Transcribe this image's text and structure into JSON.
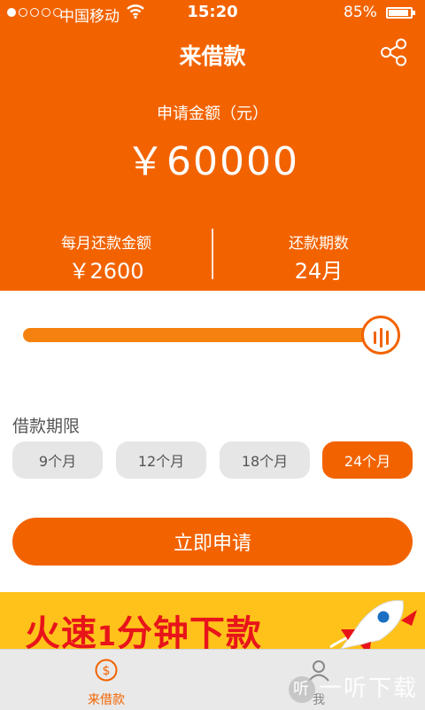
{
  "status_bar": {
    "carrier": "中国移动",
    "time": "15:20",
    "battery": "85%",
    "battery_level": 0.85,
    "signal_filled": 1,
    "signal_total": 5
  },
  "header": {
    "title": "来借款",
    "share_icon": "share-icon",
    "amount_label": "申请金额（元）",
    "amount_value": "￥60000",
    "monthly_label": "每月还款金额",
    "monthly_value": "￥2600",
    "periods_label": "还款期数",
    "periods_value": "24月"
  },
  "slider": {
    "level": 1.0,
    "color": "#f5820f"
  },
  "term": {
    "label": "借款期限",
    "options": [
      "9个月",
      "12个月",
      "18个月",
      "24个月"
    ],
    "selected": "24个月"
  },
  "apply": {
    "label": "立即申请"
  },
  "banner": {
    "text_prefix": "火速",
    "text_number": "1",
    "text_suffix": "分钟下款"
  },
  "tabbar": {
    "tabs": [
      {
        "label": "来借款",
        "icon": "dollar-coin-icon",
        "active": true
      },
      {
        "label": "我",
        "icon": "person-icon",
        "active": false
      }
    ]
  },
  "watermark": {
    "text": "一听下载",
    "logo": "听"
  },
  "colors": {
    "accent": "#f26300",
    "banner": "#ffc21a",
    "banner_text": "#e8141a"
  }
}
